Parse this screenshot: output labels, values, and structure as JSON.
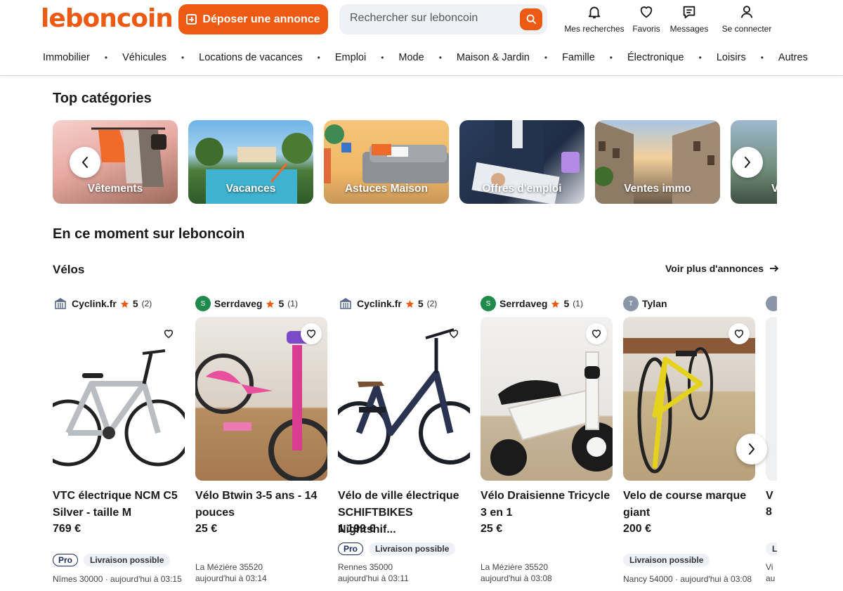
{
  "header": {
    "logo": "leboncoin",
    "post_label": "Déposer une annonce",
    "search_placeholder": "Rechercher sur leboncoin",
    "icons": [
      {
        "label": "Mes recherches",
        "icon": "bell-icon"
      },
      {
        "label": "Favoris",
        "icon": "heart-icon"
      },
      {
        "label": "Messages",
        "icon": "message-icon"
      },
      {
        "label": "Se connecter",
        "icon": "user-icon"
      }
    ],
    "categories": [
      "Immobilier",
      "Véhicules",
      "Locations de vacances",
      "Emploi",
      "Mode",
      "Maison & Jardin",
      "Famille",
      "Électronique",
      "Loisirs",
      "Autres"
    ]
  },
  "top_categories": {
    "title": "Top catégories",
    "tiles": [
      {
        "label": "Vêtements"
      },
      {
        "label": "Vacances"
      },
      {
        "label": "Astuces Maison"
      },
      {
        "label": "Offres d'emploi"
      },
      {
        "label": "Ventes immo"
      },
      {
        "label": "V"
      }
    ]
  },
  "moment": {
    "title": "En ce moment sur leboncoin",
    "subsection": "Vélos",
    "see_more": "Voir plus d'annonces",
    "listings": [
      {
        "seller": "Cyclink.fr",
        "avatar": "",
        "rating": "5",
        "count": "(2)",
        "title_lines": [
          "VTC électrique NCM C5",
          "Silver - taille M"
        ],
        "price": "769 €",
        "pro": "Pro",
        "delivery": "Livraison possible",
        "location": "",
        "date": "Nîmes 30000 · aujourd'hui à 03:15"
      },
      {
        "seller": "Serrdaveg",
        "avatar": "S",
        "rating": "5",
        "count": "(1)",
        "title_lines": [
          "Vélo Btwin 3-5 ans - 14",
          "pouces"
        ],
        "price": "25 €",
        "pro": "",
        "delivery": "",
        "location": "La Mézière 35520",
        "date": "aujourd'hui à 03:14"
      },
      {
        "seller": "Cyclink.fr",
        "avatar": "",
        "rating": "5",
        "count": "(2)",
        "title_lines": [
          "Vélo de ville électrique",
          "SCHIFTBIKES Nightshif..."
        ],
        "price": "1 199 €",
        "pro": "Pro",
        "delivery": "Livraison possible",
        "location": "Rennes 35000",
        "date": "aujourd'hui à 03:11"
      },
      {
        "seller": "Serrdaveg",
        "avatar": "S",
        "rating": "5",
        "count": "(1)",
        "title_lines": [
          "Vélo Draisienne Tricycle",
          "3 en 1"
        ],
        "price": "25 €",
        "pro": "",
        "delivery": "",
        "location": "La Mézière 35520",
        "date": "aujourd'hui à 03:08"
      },
      {
        "seller": "Tylan",
        "avatar": "T",
        "rating": "",
        "count": "",
        "title_lines": [
          "Velo de course marque",
          "giant"
        ],
        "price": "200 €",
        "pro": "",
        "delivery": "Livraison possible",
        "location": "",
        "date": "Nancy 54000 · aujourd'hui à 03:08"
      }
    ],
    "partial_card": {
      "title_start": "V",
      "price_start": "8",
      "location_start": "Vi",
      "date_start": "au",
      "badge_start": "L"
    }
  },
  "colors": {
    "brand": "#ec5a13",
    "pro_navy": "#1a2a5e",
    "avatar_green": "#1f8a4c",
    "avatar_gray": "#8a96a8",
    "star": "#ec5a13"
  }
}
